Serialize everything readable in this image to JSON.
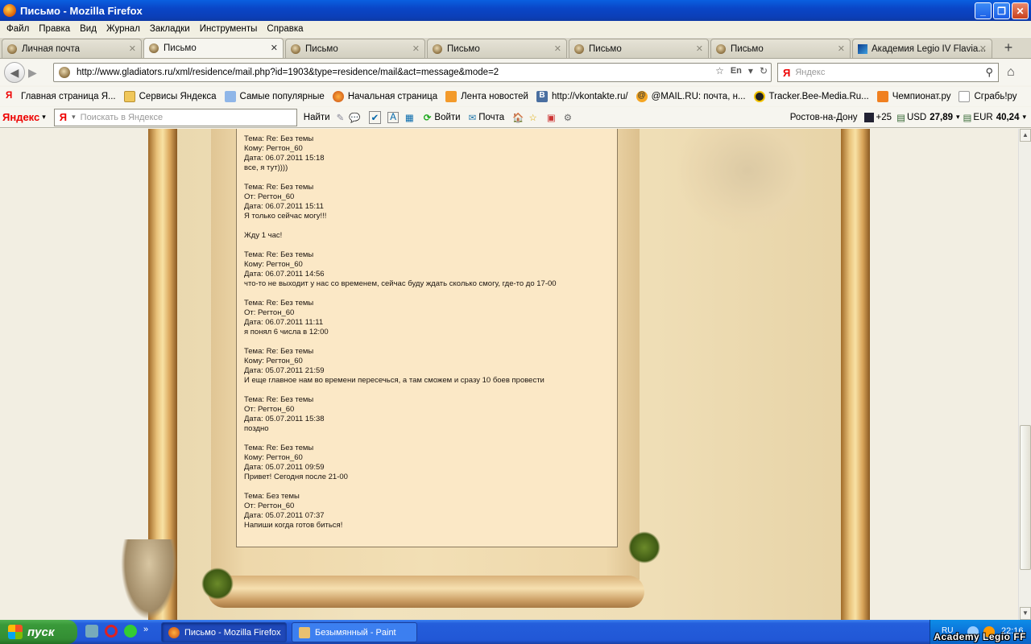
{
  "window": {
    "title": "Письмо - Mozilla Firefox"
  },
  "menu": [
    "Файл",
    "Правка",
    "Вид",
    "Журнал",
    "Закладки",
    "Инструменты",
    "Справка"
  ],
  "tabs": [
    {
      "label": "Личная почта",
      "active": false
    },
    {
      "label": "Письмо",
      "active": true
    },
    {
      "label": "Письмо",
      "active": false
    },
    {
      "label": "Письмо",
      "active": false
    },
    {
      "label": "Письмо",
      "active": false
    },
    {
      "label": "Письмо",
      "active": false
    },
    {
      "label": "Академия Legio IV Flavia...",
      "active": false
    }
  ],
  "nav": {
    "url": "http://www.gladiators.ru/xml/residence/mail.php?id=1903&type=residence/mail&act=message&mode=2",
    "lang_badge": "En",
    "search_placeholder": "Яндекс"
  },
  "bookmarks": [
    "Главная страница Я...",
    "Сервисы Яндекса",
    "Самые популярные",
    "Начальная страница",
    "Лента новостей",
    "http://vkontakte.ru/",
    "@MAIL.RU: почта, н...",
    "Tracker.Bee-Media.Ru...",
    "Чемпионат.ру",
    "Сграбь!ру"
  ],
  "yandex_bar": {
    "logo": "Яндекс",
    "search_placeholder": "Поискать в Яндексе",
    "find_label": "Найти",
    "login_label": "Войти",
    "mail_label": "Почта",
    "city": "Ростов-на-Дону",
    "weather": "+25",
    "usd_label": "USD",
    "usd_value": "27,89",
    "eur_label": "EUR",
    "eur_value": "40,24"
  },
  "messages": [
    {
      "subject": "Тема: Re: Без темы",
      "party": "Кому: Регтон_60",
      "date": "Дата: 06.07.2011 15:18",
      "body": "все, я тут))))"
    },
    {
      "subject": "Тема: Re: Без темы",
      "party": "От: Регтон_60",
      "date": "Дата: 06.07.2011 15:11",
      "body": "Я только сейчас могу!!!",
      "body2": "Жду 1 час!"
    },
    {
      "subject": "Тема: Re: Без темы",
      "party": "Кому: Регтон_60",
      "date": "Дата: 06.07.2011 14:56",
      "body": "что-то не выходит у нас со временем, сейчас буду ждать сколько смогу, где-то до 17-00"
    },
    {
      "subject": "Тема: Re: Без темы",
      "party": "От: Регтон_60",
      "date": "Дата: 06.07.2011 11:11",
      "body": "я понял 6 числа в 12:00"
    },
    {
      "subject": "Тема: Re: Без темы",
      "party": "Кому: Регтон_60",
      "date": "Дата: 05.07.2011 21:59",
      "body": "И еще главное нам во времени пересечься, а там сможем и сразу 10 боев провести"
    },
    {
      "subject": "Тема: Re: Без темы",
      "party": "От: Регтон_60",
      "date": "Дата: 05.07.2011 15:38",
      "body": "поздно"
    },
    {
      "subject": "Тема: Re: Без темы",
      "party": "Кому: Регтон_60",
      "date": "Дата: 05.07.2011 09:59",
      "body": "Привет! Сегодня после 21-00"
    },
    {
      "subject": "Тема: Без темы",
      "party": "От: Регтон_60",
      "date": "Дата: 05.07.2011 07:37",
      "body": "Напиши когда готов биться!"
    }
  ],
  "taskbar": {
    "start_label": "пуск",
    "tasks": [
      {
        "label": "Письмо - Mozilla Firefox",
        "active": true
      },
      {
        "label": "Безымянный - Paint",
        "active": false
      }
    ],
    "tray_lang": "RU",
    "clock": "22:16"
  },
  "watermark": "Academy Legio FF"
}
